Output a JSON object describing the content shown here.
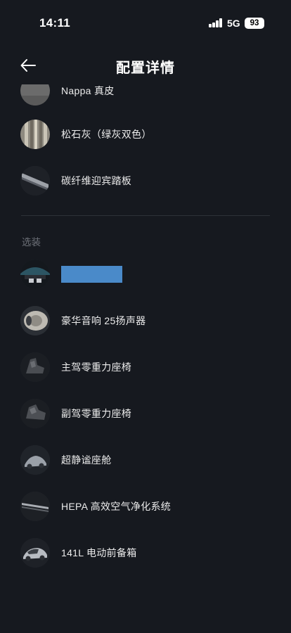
{
  "status": {
    "time": "14:11",
    "network": "5G",
    "battery": "93"
  },
  "header": {
    "title": "配置详情",
    "back_icon": "arrow-left-icon"
  },
  "standard_items": [
    {
      "label": "Nappa 真皮",
      "icon": "leather-swatch"
    },
    {
      "label": "松石灰（绿灰双色）",
      "icon": "interior-color-swatch"
    },
    {
      "label": "碳纤维迎宾踏板",
      "icon": "door-sill-plate"
    }
  ],
  "optional_section": {
    "label": "选装",
    "items": [
      {
        "label": "",
        "icon": "roof-option",
        "redacted": true,
        "redaction_color": "#4a8ac9"
      },
      {
        "label": "豪华音响 25扬声器",
        "icon": "speaker"
      },
      {
        "label": "主驾零重力座椅",
        "icon": "driver-seat"
      },
      {
        "label": "副驾零重力座椅",
        "icon": "passenger-seat"
      },
      {
        "label": "超静谧座舱",
        "icon": "quiet-cabin"
      },
      {
        "label": "HEPA 高效空气净化系统",
        "icon": "air-filter"
      },
      {
        "label": "141L 电动前备箱",
        "icon": "front-trunk"
      }
    ]
  },
  "colors": {
    "background": "#16191f",
    "text": "#ececec",
    "muted": "#6d7178",
    "divider": "#2d3138"
  }
}
